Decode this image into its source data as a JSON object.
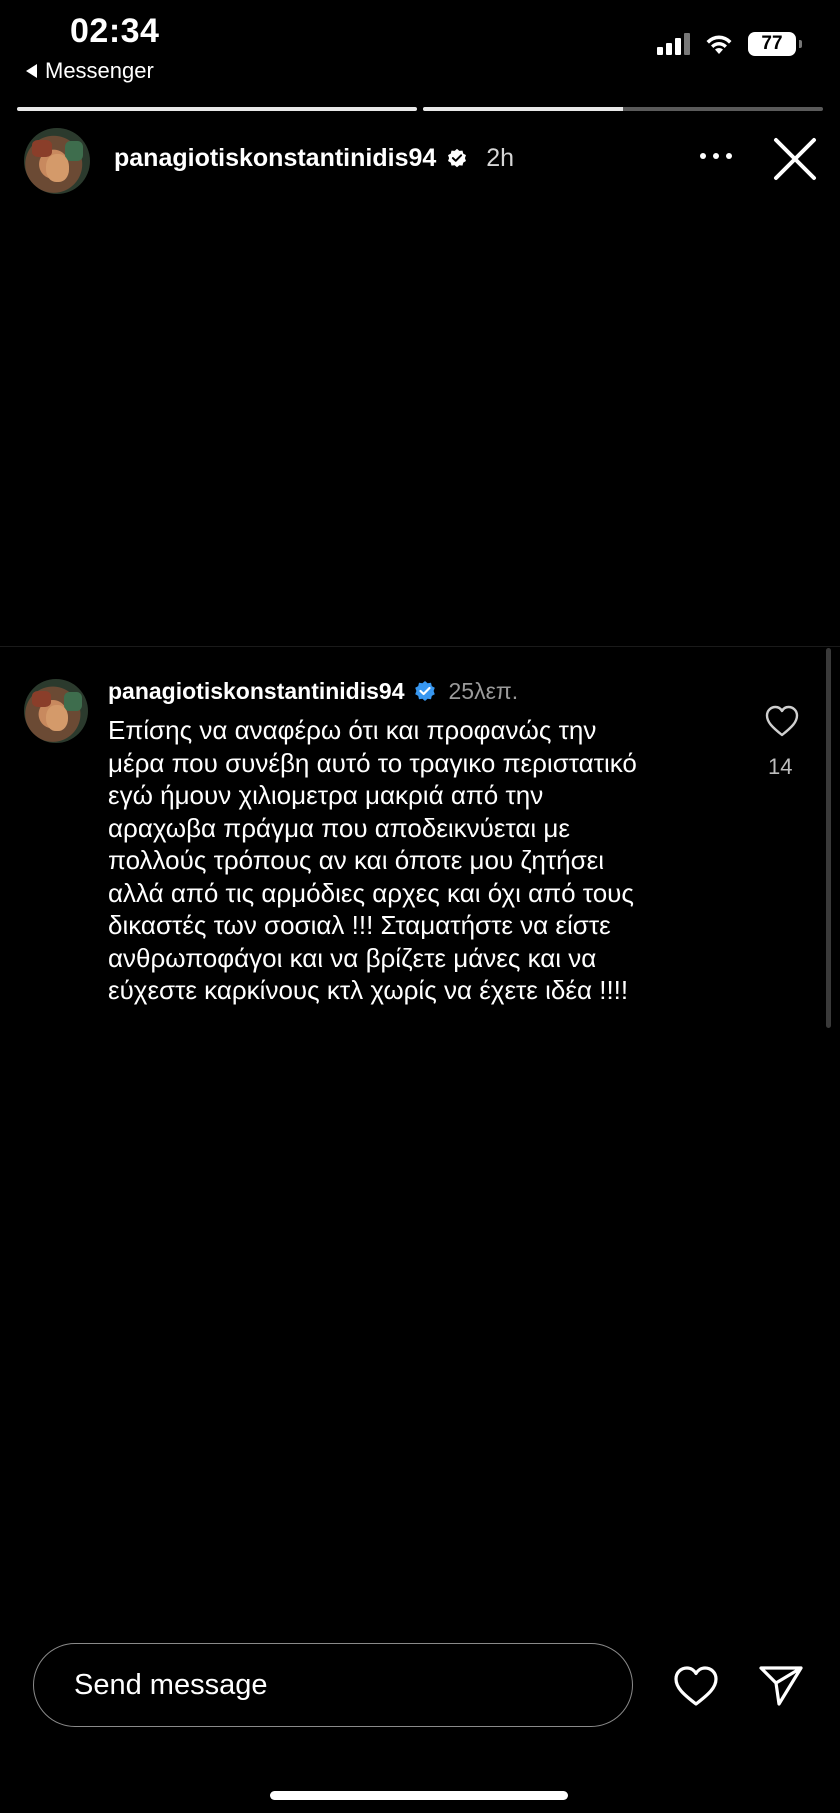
{
  "status_bar": {
    "time": "02:34",
    "back_app": "Messenger",
    "battery": "77",
    "icons": [
      "signal-icon",
      "wifi-icon",
      "battery-icon"
    ]
  },
  "story": {
    "progress": [
      1.0,
      0.5
    ],
    "username": "panagiotiskonstantinidis94",
    "time_ago": "2h",
    "menu_icon": "more-icon",
    "close_icon": "close-icon"
  },
  "comment": {
    "username": "panagiotiskonstantinidis94",
    "time_ago": "25λεπ.",
    "text": "Επίσης να αναφέρω ότι και προφανώς την\nμέρα που συνέβη αυτό το τραγικο περιστατικό\nεγώ ήμουν χιλιομετρα μακριά από την\nαραχωβα πράγμα που αποδεικνύεται με\nπολλούς τρόπους αν και όποτε μου ζητήσει\nαλλά από τις αρμόδιες αρχες και όχι από τους\nδικαστές των σοσιαλ !!! Σταματήστε να είστε\nανθρωποφάγοι και να βρίζετε μάνες και να\nεύχεστε καρκίνους κτλ χωρίς να έχετε ιδέα !!!!",
    "likes": "14",
    "verified_color": "#3897f0"
  },
  "bottom_bar": {
    "placeholder": "Send message",
    "heart_icon": "heart-icon",
    "send_icon": "send-icon"
  }
}
